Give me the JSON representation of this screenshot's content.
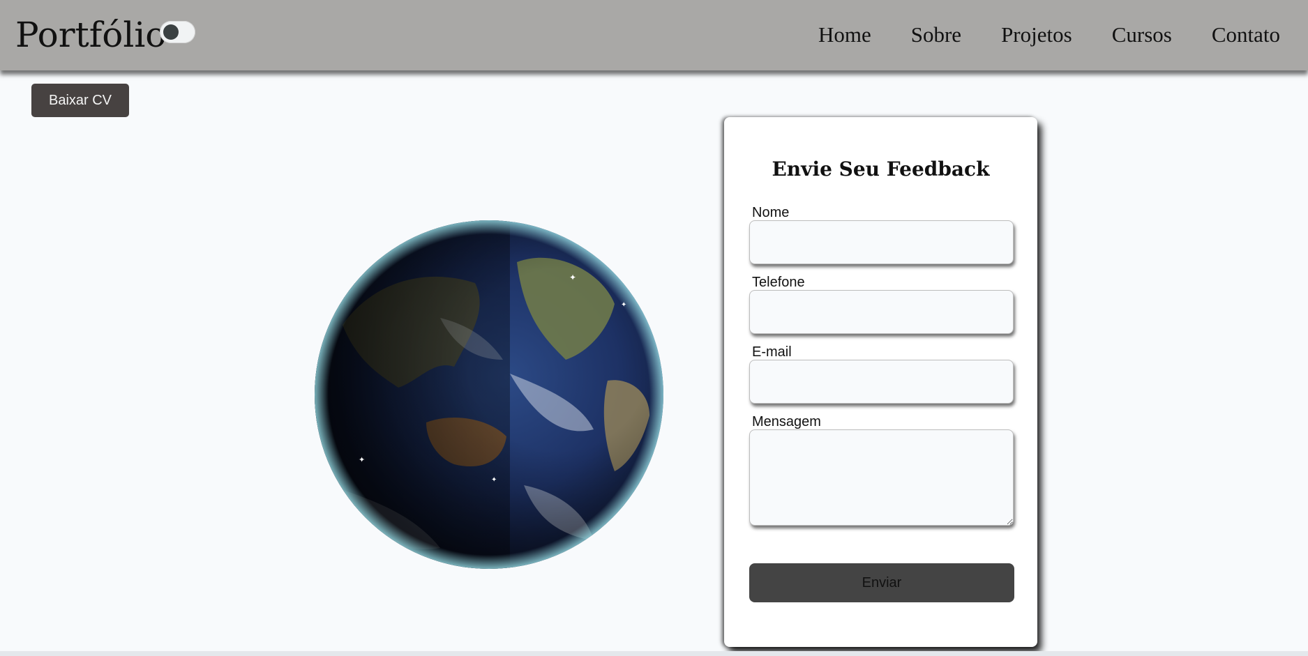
{
  "header": {
    "logo": "Portfólio",
    "nav": [
      "Home",
      "Sobre",
      "Projetos",
      "Cursos",
      "Contato"
    ]
  },
  "cv_button": "Baixar CV",
  "form": {
    "title": "Envie Seu Feedback",
    "fields": {
      "name_label": "Nome",
      "phone_label": "Telefone",
      "email_label": "E-mail",
      "message_label": "Mensagem"
    },
    "submit": "Enviar"
  },
  "theme_toggle": {
    "on": false
  },
  "colors": {
    "header_bg": "#a9a8a6",
    "page_bg": "#f8fafc",
    "button_dark": "#474241",
    "submit_bg": "#444444"
  },
  "icons": [
    "theme-toggle-icon",
    "earth-globe-image"
  ]
}
